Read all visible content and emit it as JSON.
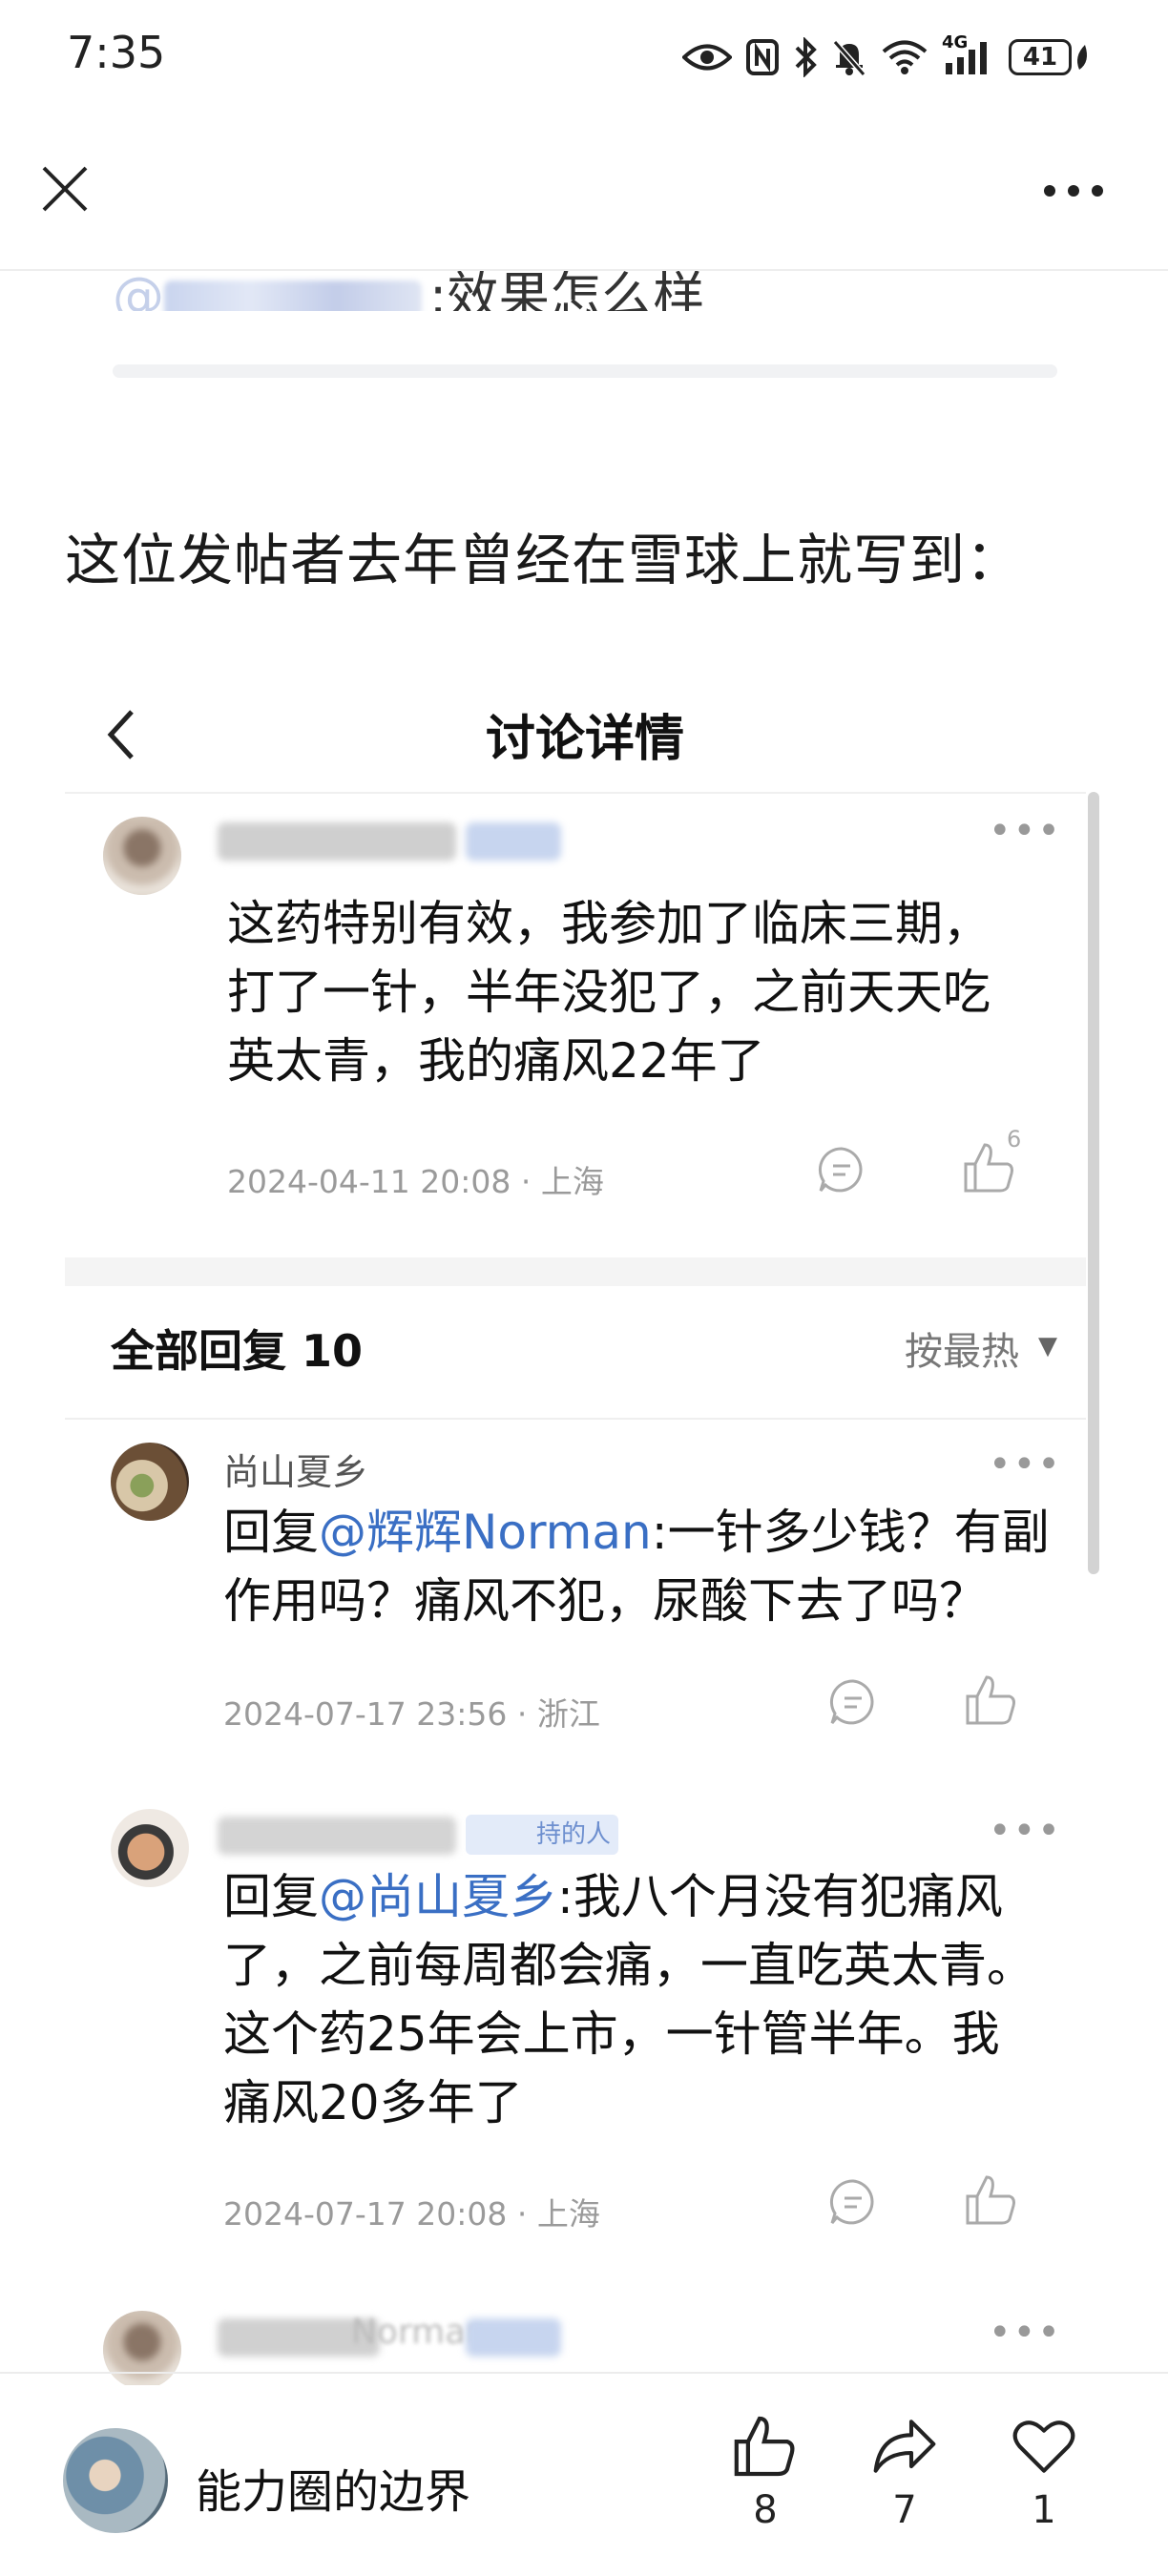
{
  "status_bar": {
    "time": "7:35",
    "battery": "41",
    "network": "4G"
  },
  "quote_snippet": {
    "text": ":效果怎么样",
    "mention_char": "@"
  },
  "paragraph": "这位发帖者去年曾经在雪球上就写到：",
  "embedded": {
    "title": "讨论详情",
    "post": {
      "text_lines": [
        "这药特别有效，我参加了临床三期，",
        "打了一针，半年没犯了，之前天天吃",
        "英太青，我的痛风22年了"
      ],
      "meta": "2024-04-11 20:08 · 上海",
      "likes": "6"
    },
    "replies_header": {
      "title": "全部回复 10",
      "sort": "按最热",
      "caret": "▼"
    },
    "replies": [
      {
        "name": "尚山夏乡",
        "prefix": "回复",
        "mention": "@辉辉Norman",
        "text_lines": [
          ":一针多少钱？有副",
          "作用吗？痛风不犯，尿酸下去了吗？"
        ],
        "meta": "2024-07-17 23:56 · 浙江"
      },
      {
        "name_suffix": "持的人",
        "prefix": "回复",
        "mention": "@尚山夏乡",
        "text_lines": [
          ":我八个月没有犯痛风",
          "了，之前每周都会痛，一直吃英太青。",
          "这个药25年会上市，一针管半年。我",
          "痛风20多年了"
        ],
        "meta": "2024-07-17 20:08 · 上海"
      }
    ],
    "partial_name": "Norman"
  },
  "bottom_bar": {
    "author": "能力圈的边界",
    "likes": "8",
    "shares": "7",
    "favorites": "1"
  },
  "colors": {
    "mention": "#3a6fc4",
    "meta": "#9a9a9a"
  }
}
